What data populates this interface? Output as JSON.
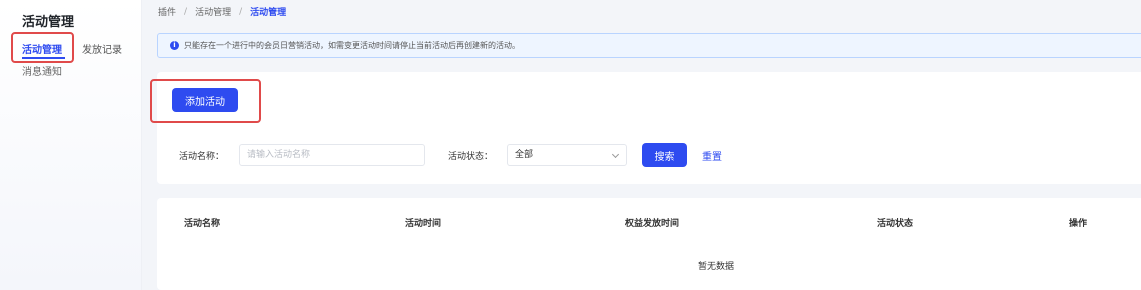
{
  "sidebar": {
    "title": "活动管理",
    "items": [
      {
        "label": "活动管理",
        "active": true
      },
      {
        "label": "发放记录"
      },
      {
        "label": "消息通知"
      }
    ]
  },
  "breadcrumb": [
    "插件",
    "活动管理",
    "活动管理"
  ],
  "notice": {
    "icon": "info-icon",
    "text": "只能存在一个进行中的会员日营销活动，如需变更活动时间请停止当前活动后再创建新的活动。"
  },
  "toolbar": {
    "add_label": "添加活动"
  },
  "filters": {
    "name_label": "活动名称：",
    "name_placeholder": "请输入活动名称",
    "status_label": "活动状态：",
    "status_value": "全部",
    "search_label": "搜索",
    "reset_label": "重置"
  },
  "table": {
    "headers": [
      "活动名称",
      "活动时间",
      "权益发放时间",
      "活动状态",
      "操作"
    ],
    "empty_text": "暂无数据"
  },
  "colors": {
    "accent": "#2e4bf0",
    "highlight": "#e04a4a"
  }
}
